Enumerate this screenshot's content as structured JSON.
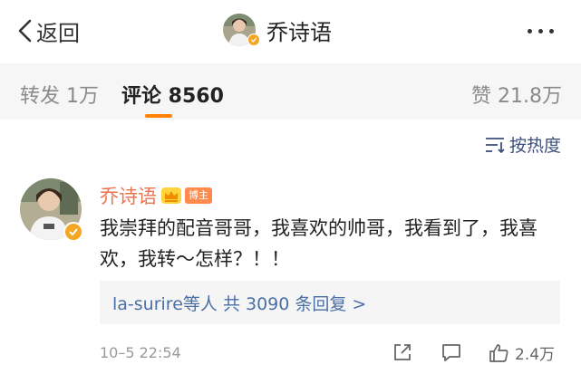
{
  "nav": {
    "back_label": "返回",
    "title": "乔诗语"
  },
  "tabs": [
    {
      "label": "转发 1万"
    },
    {
      "label": "评论 8560"
    },
    {
      "label": "赞 21.8万"
    }
  ],
  "sort": {
    "label": "按热度"
  },
  "comment": {
    "author": "乔诗语",
    "badge": "博主",
    "text": "我崇拜的配音哥哥，我喜欢的帅哥，我看到了，我喜欢，我转～怎样？！！",
    "replies": {
      "user": "la-surire",
      "middle": "等人  ",
      "count_text": "共 3090 条回复 >"
    },
    "time": "10–5 22:54",
    "likes": "2.4万"
  },
  "colors": {
    "accent": "#ff8200",
    "author_name": "#eb7350",
    "link": "#4a6fa5",
    "verified": "#f5a623"
  },
  "icons": [
    "chevron-left-icon",
    "more-icon",
    "sort-icon",
    "verified-icon",
    "crown-icon",
    "share-icon",
    "comment-icon",
    "thumbs-up-icon"
  ]
}
